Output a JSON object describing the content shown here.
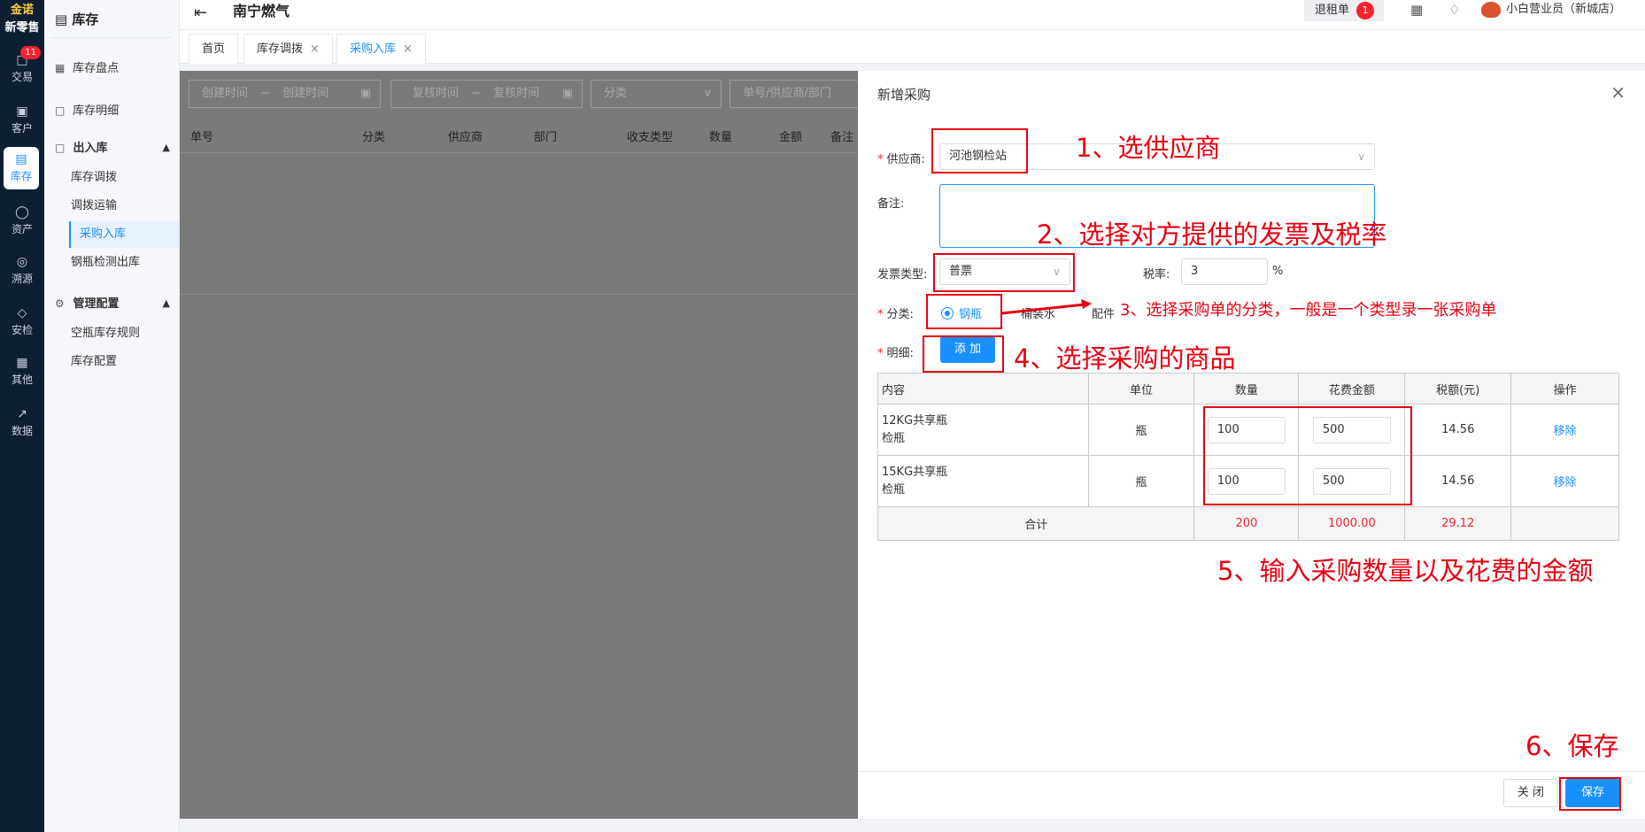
{
  "rail": {
    "brand_line1": "金诺",
    "brand_line2": "新零售",
    "items": [
      {
        "label": "交易",
        "badge": "11"
      },
      {
        "label": "客户"
      },
      {
        "label": "库存"
      },
      {
        "label": "资产"
      },
      {
        "label": "溯源"
      },
      {
        "label": "安检"
      },
      {
        "label": "其他"
      },
      {
        "label": "数据"
      }
    ]
  },
  "sidebar": {
    "title": "库存",
    "items": [
      {
        "label": "库存盘点"
      },
      {
        "label": "库存明细"
      },
      {
        "label": "出入库"
      },
      {
        "label": "库存调拨"
      },
      {
        "label": "调拨运输"
      },
      {
        "label": "采购入库"
      },
      {
        "label": "钢瓶检测出库"
      },
      {
        "label": "管理配置"
      },
      {
        "label": "空瓶库存规则"
      },
      {
        "label": "库存配置"
      }
    ]
  },
  "header": {
    "org": "南宁燃气",
    "rent_label": "退租单",
    "rent_count": "1",
    "user": "小白营业员（新城店）"
  },
  "tabs": [
    {
      "label": "首页"
    },
    {
      "label": "库存调拨"
    },
    {
      "label": "采购入库"
    }
  ],
  "filters": {
    "create_start": "创建时间",
    "create_end": "创建时间",
    "review_start": "复核时间",
    "review_end": "复核时间",
    "tilde": "~",
    "category": "分类",
    "search": "单号/供应商/部门"
  },
  "list_columns": [
    "单号",
    "分类",
    "供应商",
    "部门",
    "收支类型",
    "数量",
    "金额",
    "备注"
  ],
  "drawer": {
    "title": "新增采购",
    "supplier_label": "供应商:",
    "supplier_value": "河池钢检站",
    "remark_label": "备注:",
    "invoice_label": "发票类型:",
    "invoice_value": "普票",
    "tax_label": "税率:",
    "tax_value": "3",
    "tax_unit": "%",
    "category_label": "分类:",
    "category_options": [
      "钢瓶",
      "桶装水",
      "配件"
    ],
    "detail_label": "明细:",
    "add_button": "添 加",
    "table": {
      "headers": [
        "内容",
        "单位",
        "数量",
        "花费金额",
        "税额(元)",
        "操作"
      ],
      "rows": [
        {
          "content_1": "12KG共享瓶",
          "content_2": "检瓶",
          "unit": "瓶",
          "qty": "100",
          "amount": "500",
          "tax": "14.56",
          "action": "移除"
        },
        {
          "content_1": "15KG共享瓶",
          "content_2": "检瓶",
          "unit": "瓶",
          "qty": "100",
          "amount": "500",
          "tax": "14.56",
          "action": "移除"
        }
      ],
      "total_label": "合计",
      "total_qty": "200",
      "total_amount": "1000.00",
      "total_tax": "29.12"
    },
    "close_button": "关 闭",
    "save_button": "保存"
  },
  "annotations": {
    "a1": "1、选供应商",
    "a2": "2、选择对方提供的发票及税率",
    "a3": "3、选择采购单的分类，一般是一个类型录一张采购单",
    "a4": "4、选择采购的商品",
    "a5": "5、输入采购数量以及花费的金额",
    "a6": "6、保存"
  },
  "colors": {
    "accent": "#1890ff",
    "annotation": "#e60012",
    "rail": "#0e1f33"
  }
}
